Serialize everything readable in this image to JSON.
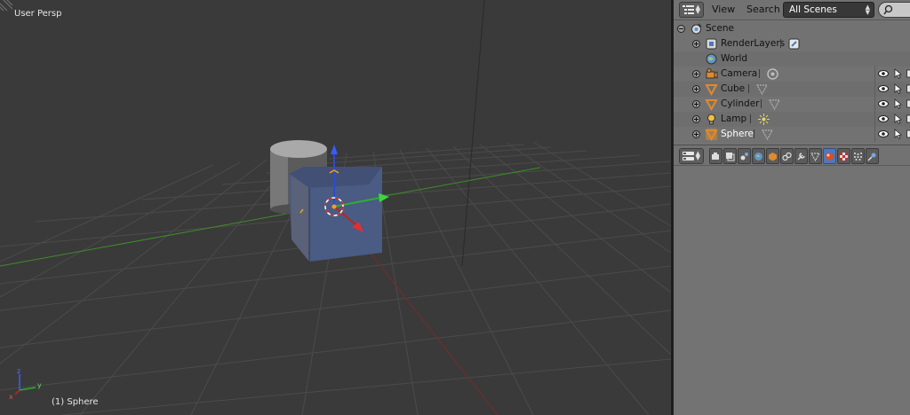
{
  "viewport": {
    "view_name": "User Persp",
    "active_object": "(1) Sphere",
    "axis_labels": {
      "x": "x",
      "y": "y",
      "z": "z"
    }
  },
  "outliner_header": {
    "menu_view": "View",
    "menu_search": "Search",
    "scene_filter": "All Scenes"
  },
  "outliner": {
    "scene": "Scene",
    "items": [
      {
        "label": "RenderLayers",
        "icon": "render-layers-icon",
        "restrict": false
      },
      {
        "label": "World",
        "icon": "world-icon",
        "restrict": false
      },
      {
        "label": "Camera",
        "icon": "camera-icon",
        "restrict": true
      },
      {
        "label": "Cube",
        "icon": "mesh-icon",
        "restrict": true
      },
      {
        "label": "Cylinder",
        "icon": "mesh-icon",
        "restrict": true
      },
      {
        "label": "Lamp",
        "icon": "lamp-icon",
        "restrict": true
      },
      {
        "label": "Sphere",
        "icon": "mesh-icon",
        "restrict": true
      }
    ]
  },
  "properties": {
    "tabs": [
      "render-icon",
      "render-layers-icon",
      "scene-icon",
      "world-icon",
      "object-icon",
      "constraints-icon",
      "modifiers-icon",
      "data-icon",
      "material-icon",
      "texture-icon",
      "particles-icon",
      "physics-icon"
    ],
    "active_tab": 8
  },
  "colors": {
    "viewport_bg": "#3a3a3a",
    "grid": "#4a4a4a",
    "x_axis": "#9a2f2f",
    "y_axis": "#3f9a2a",
    "selected": "#4b78c0",
    "panel_bg": "#737373"
  }
}
